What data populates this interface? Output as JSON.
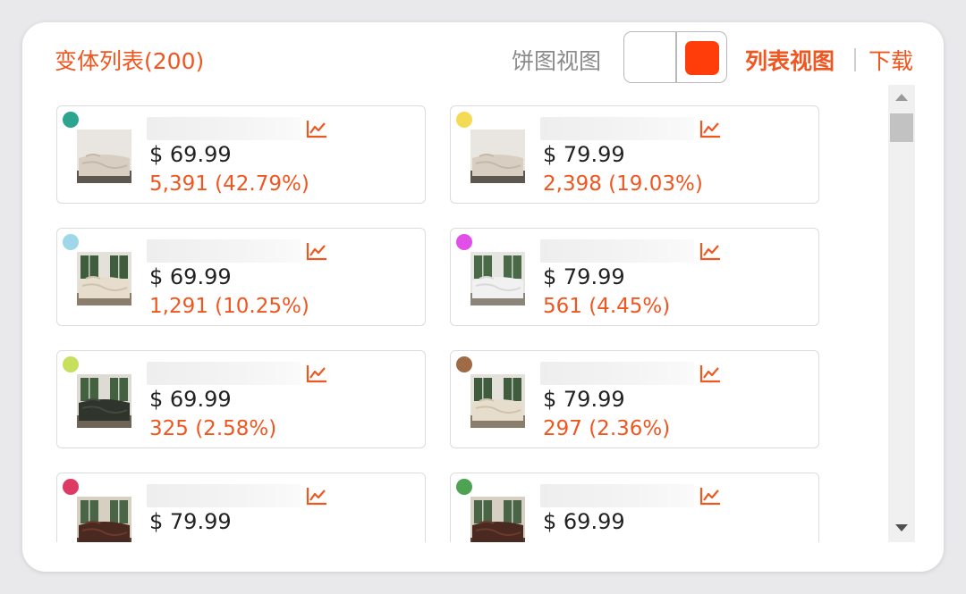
{
  "header": {
    "title": "变体列表(200)",
    "pie_view_label": "饼图视图",
    "list_view_label": "列表视图",
    "download_label": "下载",
    "accent_color": "#f0561f",
    "toggle_color": "#ff3d0a"
  },
  "variants": [
    {
      "dot_color": "#2ba58e",
      "price": "$ 69.99",
      "sales": "5,391 (42.79%)",
      "thumb": "beige"
    },
    {
      "dot_color": "#f5da55",
      "price": "$ 79.99",
      "sales": "2,398 (19.03%)",
      "thumb": "beige"
    },
    {
      "dot_color": "#9fd7ea",
      "price": "$ 69.99",
      "sales": "1,291 (10.25%)",
      "thumb": "window-beige"
    },
    {
      "dot_color": "#e24ee8",
      "price": "$ 79.99",
      "sales": "561 (4.45%)",
      "thumb": "window-white"
    },
    {
      "dot_color": "#c6df5c",
      "price": "$ 69.99",
      "sales": "325 (2.58%)",
      "thumb": "window-dark"
    },
    {
      "dot_color": "#a06a45",
      "price": "$ 79.99",
      "sales": "297 (2.36%)",
      "thumb": "window-beige"
    },
    {
      "dot_color": "#dd3b63",
      "price": "$ 79.99",
      "sales": "",
      "thumb": "window-brown"
    },
    {
      "dot_color": "#4ea352",
      "price": "$ 69.99",
      "sales": "",
      "thumb": "window-brown"
    }
  ],
  "icons": {
    "trend": "trend-chart-icon",
    "scroll_up": "scroll-up-arrow-icon",
    "scroll_down": "scroll-down-arrow-icon"
  }
}
